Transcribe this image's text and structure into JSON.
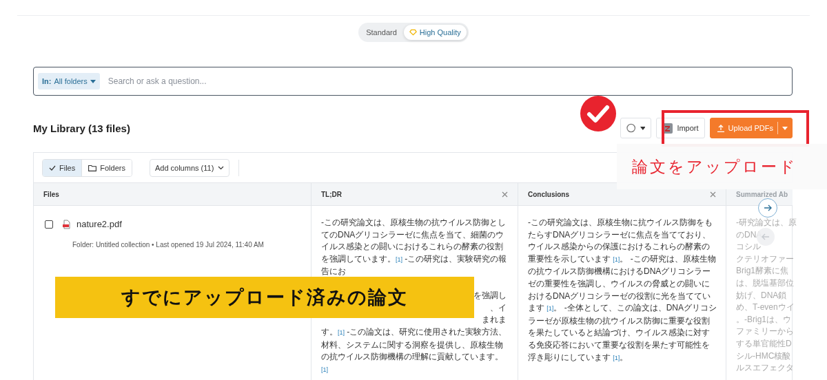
{
  "quality_toggle": {
    "options": [
      {
        "label": "Standard",
        "selected": false
      },
      {
        "label": "High Quality",
        "selected": true
      }
    ]
  },
  "search": {
    "scope_label": "In:",
    "scope_value": "All folders",
    "placeholder": "Search or ask a question..."
  },
  "library": {
    "title": "My Library (13 files)",
    "import_label": "Import",
    "upload_label": "Upload PDFs"
  },
  "view_toggle": [
    {
      "label": "Files",
      "kind": "files",
      "selected": true
    },
    {
      "label": "Folders",
      "kind": "folders",
      "selected": false
    }
  ],
  "add_columns": "Add columns (11)",
  "table": {
    "columns": [
      {
        "label": "Files",
        "closable": false
      },
      {
        "label": "TL;DR",
        "closable": true
      },
      {
        "label": "Conclusions",
        "closable": true
      },
      {
        "label": "Summarized Ab",
        "closable": false
      }
    ],
    "rows": [
      {
        "checked": false,
        "file_name": "nature2.pdf",
        "meta_folder": "Folder: Untitled collection •",
        "meta_opened": "Last opened 19 Jul 2024, 11:40 AM",
        "tldr": {
          "before": [
            {
              "kind": "text",
              "text": "-この研究論文は、原核生物の抗ウイルス防御としてのDNAグリコシラーゼに焦点を当て、細菌のウイルス感染との闘いにおけるこれらの酵素の役割を強調しています。"
            },
            {
              "kind": "ref",
              "text": "[1]"
            },
            {
              "kind": "text",
              "text": " -この研究は、実験研究の報告にお"
            }
          ],
          "fragments": [
            "を強調し",
            "、イ",
            "まれま"
          ],
          "after": [
            {
              "kind": "text",
              "text": "す。"
            },
            {
              "kind": "ref",
              "text": "[1]"
            },
            {
              "kind": "text",
              "text": " -この論文は、研究に使用された実験方法、材料、システムに関する洞察を提供し、原核生物の抗ウイルス防御機構の理解に貢献しています。"
            },
            {
              "kind": "ref",
              "text": "[1]"
            }
          ]
        },
        "conclusions": [
          {
            "kind": "text",
            "text": "-この研究論文は、原核生物に抗ウイルス防御をもたらすDNAグリコシラーゼに焦点を当てており、ウイルス感染からの保護におけるこれらの酵素の重要性を示しています "
          },
          {
            "kind": "ref",
            "text": "[1]"
          },
          {
            "kind": "text",
            "text": "。 -この研究は、原核生物の抗ウイルス防御機構におけるDNAグリコシラーゼの重要性を強調し、ウイルスの脅威との闘いにおけるDNAグリコシラーゼの役割に光を当てています "
          },
          {
            "kind": "ref",
            "text": "[1]"
          },
          {
            "kind": "text",
            "text": "。 -全体として、この論文は、DNAグリコシラーゼが原核生物の抗ウイルス防御に重要な役割を果たしていると結論づけ、ウイルス感染に対する免疫応答において重要な役割を果たす可能性を浮き彫りにしています "
          },
          {
            "kind": "ref",
            "text": "[1]"
          },
          {
            "kind": "text",
            "text": "。"
          }
        ],
        "summary_lines": [
          "-研究論文は、原",
          "のDNA",
          "コシル",
          "クテリオファー",
          "Brig1酵素に焦",
          "は、脱塩基部位",
          "妨げ、DNA鎖",
          "め、T-evenウイ",
          "。-Brig1は、ウ",
          "ファミリーから",
          "する単官能性D",
          "シル-HMC核酸",
          "ルスエフェクタ"
        ]
      }
    ]
  },
  "annotations": {
    "upload_label": "論文をアップロード",
    "uploaded_banner": "すでにアップロード済みの論文"
  }
}
